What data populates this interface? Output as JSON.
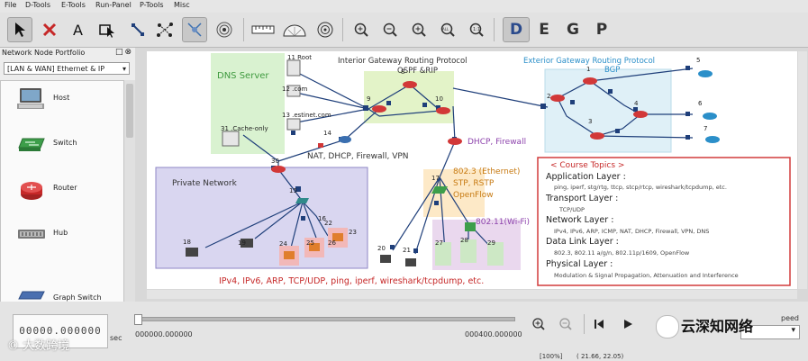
{
  "menu": [
    "File",
    "D-Tools",
    "E-Tools",
    "Run-Panel",
    "P-Tools",
    "Misc"
  ],
  "toolbar": {
    "tools": [
      "select-tool",
      "delete-tool",
      "text-tool",
      "rectangle-select-tool",
      "link-tool",
      "subnet-tool",
      "auto-layout-tool",
      "move-tool",
      "antenna-tool"
    ],
    "zoom_tools": [
      "ruler-tool",
      "protractor-tool",
      "zoom-in-tool",
      "zoom-out-tool",
      "zoom-fit-tool",
      "zoom-all-tool",
      "zoom-reset-tool"
    ],
    "modes": [
      "D",
      "E",
      "G",
      "P"
    ],
    "active_mode": "D"
  },
  "panel": {
    "title": "Network Node Portfolio",
    "controls": "□⊗",
    "selected": "[LAN & WAN] Ethernet & IP",
    "devices": [
      "Host",
      "Switch",
      "Router",
      "Hub",
      "Graph Switch"
    ]
  },
  "canvas": {
    "regions": {
      "dns": "DNS Server",
      "igp": "Interior Gateway Routing Protocol",
      "igp_sub": "OSPF &RIP",
      "egp": "Exterior Gateway Routing Protocol",
      "egp_sub": "BGP",
      "private": "Private Network",
      "ethernet": "802.3 (Ethernet)",
      "stp": "STP, RSTP",
      "openflow": "OpenFlow",
      "wifi": "802.11(Wi-Fi)",
      "nat": "NAT, DHCP, Firewall, VPN",
      "dhcp": "DHCP, Firewall",
      "protocols": "IPv4, IPv6, ARP, TCP/UDP, ping, iperf, wireshark/tcpdump, etc."
    },
    "node_labels": {
      "n11": "11 Root",
      "n12": "12 .com",
      "n13": "13 .estinet.com",
      "n31": "31 .Cache-only",
      "n1": "1",
      "n2": "2",
      "n3": "3",
      "n4": "4",
      "n5": "5",
      "n6": "6",
      "n7": "7",
      "n8": "8",
      "n9": "9",
      "n10": "10",
      "n14": "14",
      "n30": "30",
      "n15": "15",
      "n16": "16",
      "n17": "17",
      "n18": "18",
      "n19": "19",
      "n20": "20",
      "n21": "21",
      "n22": "22",
      "n23": "23",
      "n24": "24",
      "n25": "25",
      "n26": "26",
      "n27": "27",
      "n28": "28",
      "n29": "29"
    },
    "topics": {
      "heading": "< Course Topics >",
      "app_layer": "Application Layer :",
      "app_items": "ping, iperf, stg/rtg, ttcp, stcp/rtcp, wireshark/tcpdump, etc.",
      "transport_layer": "Transport Layer :",
      "transport_items": "TCP/UDP",
      "network_layer": "Network Layer :",
      "network_items": "IPv4, IPv6, ARP, ICMP, NAT, DHCP, Firewall, VPN, DNS",
      "datalink_layer": "Data Link Layer :",
      "datalink_items": "802.3, 802.11 a/g/n, 802.11p/1609, OpenFlow",
      "physical_layer": "Physical Layer :",
      "physical_items": "Modulation & Signal Propagation, Attenuation and Interference"
    }
  },
  "bottom": {
    "clock": "00000.000000",
    "sec": "sec",
    "time_start": "000000.000000",
    "time_end": "000400.000000",
    "speed_label": "peed",
    "zoom": "[100%]",
    "coords": "( 21.66, 22.05)"
  },
  "watermarks": {
    "left": "© 大数跨境",
    "right": "云深知网络"
  },
  "colors": {
    "dns_region": "#d9f2d0",
    "igp_region": "#e3f3c8",
    "egp_region": "#dff0f7",
    "private_region": "#d9d6f0",
    "ethernet_region": "#fde9c7",
    "wifi_region": "#ead8ee",
    "topics_border": "#d23b3b",
    "router": "#d23838",
    "link": "#1f3f7a",
    "red_text": "#c62828",
    "blue_text": "#2b8fc9"
  }
}
